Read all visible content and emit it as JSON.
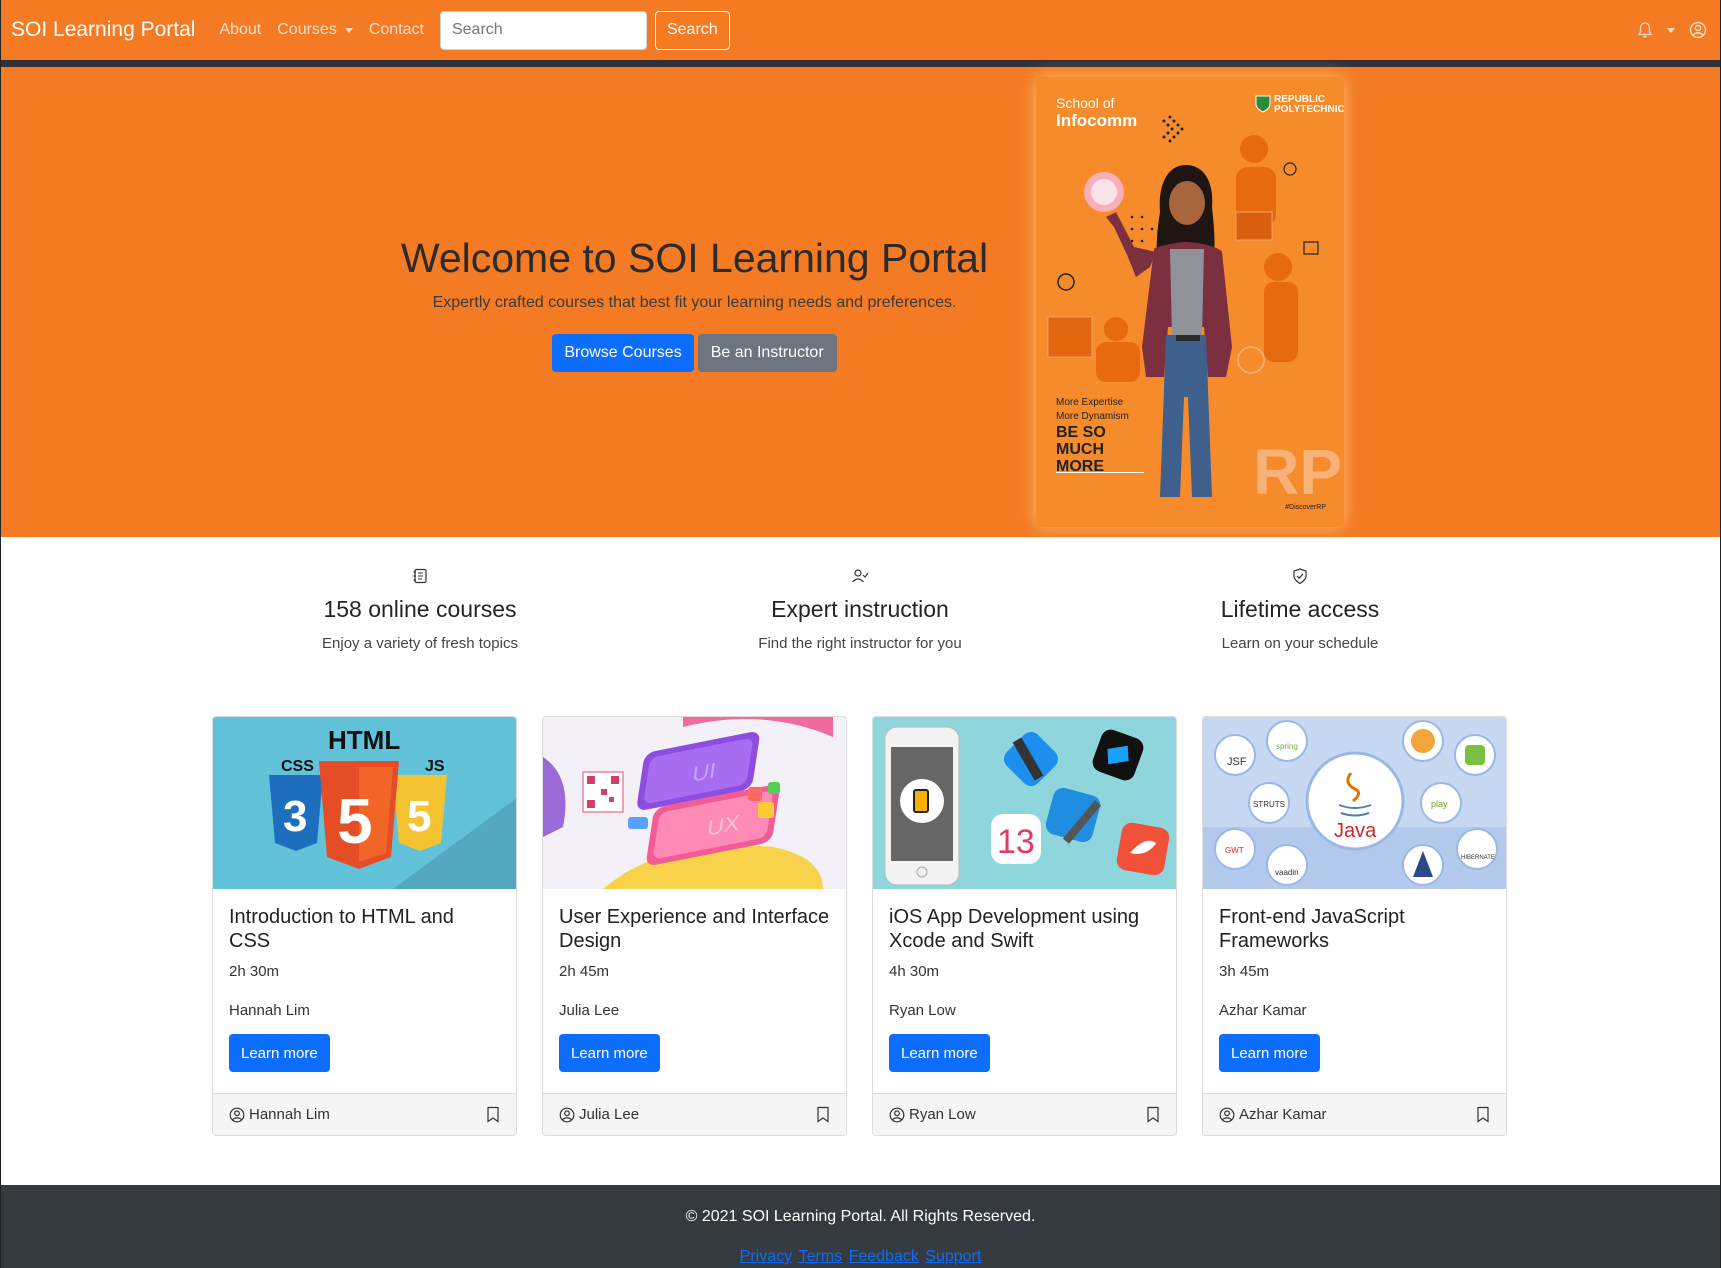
{
  "nav": {
    "brand": "SOI Learning Portal",
    "about": "About",
    "courses": "Courses",
    "contact": "Contact",
    "search_placeholder": "Search",
    "search_button": "Search"
  },
  "hero": {
    "title": "Welcome to SOI Learning Portal",
    "subtitle": "Expertly crafted courses that best fit your learning needs and preferences.",
    "browse_button": "Browse Courses",
    "instructor_button": "Be an Instructor",
    "poster": {
      "school_of": "School of",
      "infocomm": "Infocomm",
      "logo_text": "REPUBLIC POLYTECHNIC",
      "tag1": "More Expertise",
      "tag2": "More Dynamism",
      "tagline": "BE SO MUCH MORE",
      "rp": "RP",
      "hashtag": "#DiscoverRP"
    }
  },
  "features": [
    {
      "icon": "journal-icon",
      "title": "158 online courses",
      "text": "Enjoy a variety of fresh topics"
    },
    {
      "icon": "person-check-icon",
      "title": "Expert instruction",
      "text": "Find the right instructor for you"
    },
    {
      "icon": "shield-check-icon",
      "title": "Lifetime access",
      "text": "Learn on your schedule"
    }
  ],
  "courses": [
    {
      "title": "Introduction to HTML and CSS",
      "duration": "2h 30m",
      "instructor": "Hannah Lim",
      "button": "Learn more",
      "image": "html-css-js-logos"
    },
    {
      "title": "User Experience and Interface Design",
      "duration": "2h 45m",
      "instructor": "Julia Lee",
      "button": "Learn more",
      "image": "ui-ux-phones"
    },
    {
      "title": "iOS App Development using Xcode and Swift",
      "duration": "4h 30m",
      "instructor": "Ryan Low",
      "button": "Learn more",
      "image": "xcode-swift-icons"
    },
    {
      "title": "Front-end JavaScript Frameworks",
      "duration": "3h 45m",
      "instructor": "Azhar Kamar",
      "button": "Learn more",
      "image": "java-frameworks"
    }
  ],
  "image_text": {
    "html": "HTML",
    "css": "CSS",
    "js": "JS",
    "ui": "UI",
    "ux": "UX",
    "ios13": "13",
    "java": "Java",
    "jsf": "JSF",
    "spring": "spring",
    "struts": "STRUTS",
    "play": "play",
    "gwt": "GWT",
    "vaadin": "vaadin",
    "hibernate": "HIBERNATE"
  },
  "footer": {
    "copyright": "© 2021 SOI Learning Portal. All Rights Reserved.",
    "links": [
      "Privacy",
      "Terms",
      "Feedback",
      "Support"
    ]
  },
  "colors": {
    "brand_orange": "#f47a24",
    "primary_blue": "#0d6efd",
    "secondary_gray": "#6c757d",
    "footer_dark": "#343a40"
  }
}
